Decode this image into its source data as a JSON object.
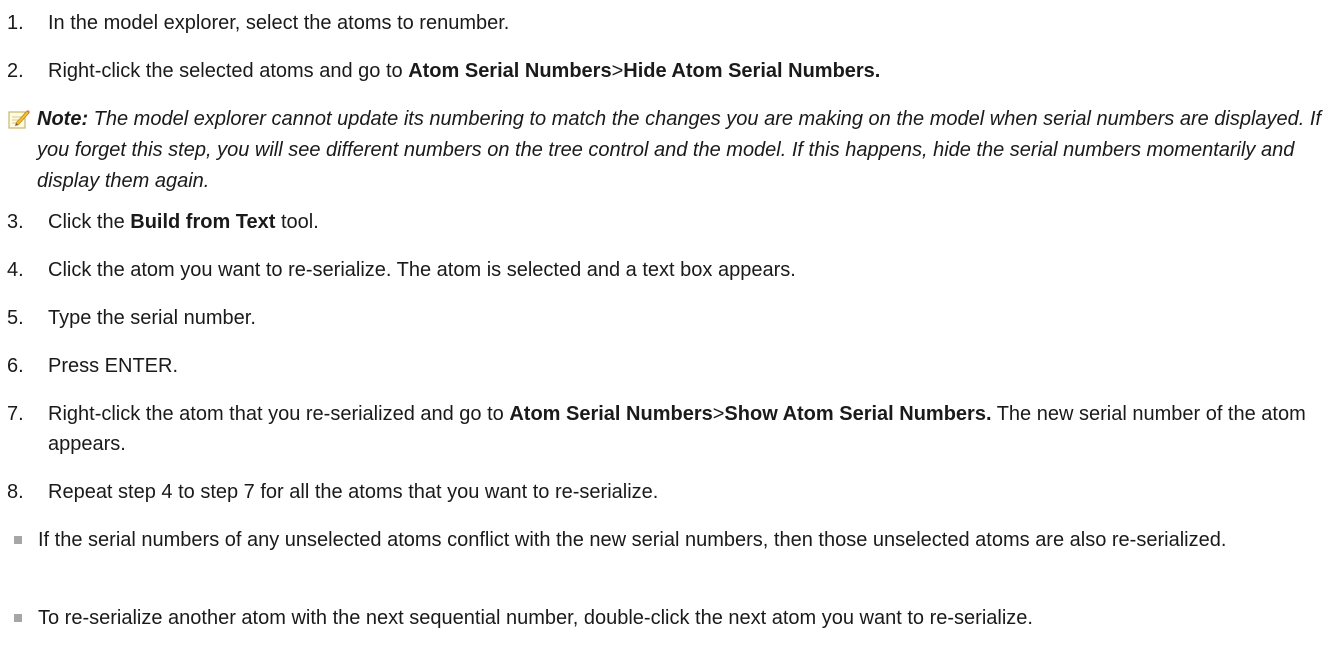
{
  "steps": [
    {
      "num": "1.",
      "parts": [
        {
          "t": "In the model explorer, select the atoms to renumber."
        }
      ]
    },
    {
      "num": "2.",
      "parts": [
        {
          "t": "Right-click the selected atoms and go to "
        },
        {
          "t": "Atom Serial Numbers",
          "b": true
        },
        {
          "t": ">"
        },
        {
          "t": "Hide Atom Serial Numbers.",
          "b": true
        }
      ]
    },
    {
      "num": "3.",
      "parts": [
        {
          "t": "Click the "
        },
        {
          "t": "Build from Text",
          "b": true
        },
        {
          "t": " tool."
        }
      ]
    },
    {
      "num": "4.",
      "parts": [
        {
          "t": "Click the atom you want to re-serialize. The atom is selected and a text box appears."
        }
      ]
    },
    {
      "num": "5.",
      "parts": [
        {
          "t": "Type the serial number."
        }
      ]
    },
    {
      "num": "6.",
      "parts": [
        {
          "t": "Press ENTER."
        }
      ]
    },
    {
      "num": "7.",
      "parts": [
        {
          "t": "Right-click the atom that you re-serialized and go to "
        },
        {
          "t": "Atom Serial Numbers",
          "b": true
        },
        {
          "t": ">"
        },
        {
          "t": "Show Atom Serial Numbers.",
          "b": true
        },
        {
          "t": " The new serial number of the atom appears."
        }
      ]
    },
    {
      "num": "8.",
      "parts": [
        {
          "t": "Repeat step 4 to step 7 for all the atoms that you want to re-serialize."
        }
      ]
    }
  ],
  "note": {
    "label": "Note:",
    "text": " The model explorer cannot update its numbering to match the changes you are making on the model when serial numbers are displayed. If you forget this step, you will see different numbers on the tree control and the model. If this happens, hide the serial numbers momentarily and display them again.",
    "icon": "note-pencil-icon"
  },
  "bullets": [
    "If the serial numbers of any unselected atoms conflict with the new serial numbers, then those unselected atoms are also re-serialized.",
    "To re-serialize another atom with the next sequential number, double-click the next atom you want to re-serialize."
  ]
}
